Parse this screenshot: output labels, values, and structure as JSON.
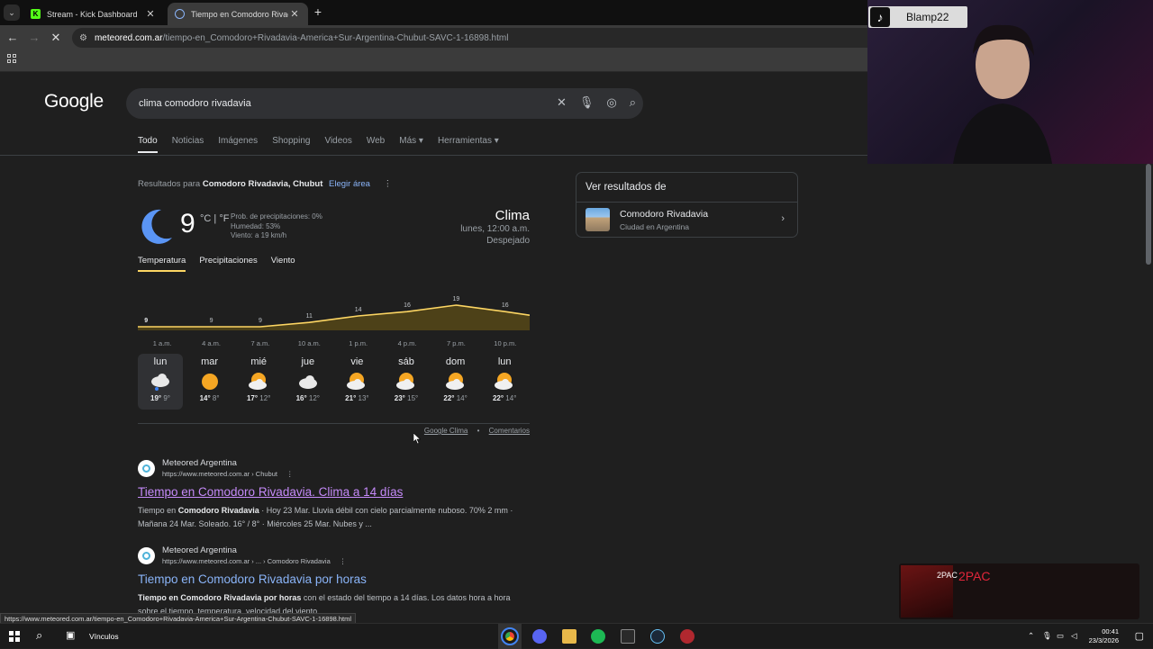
{
  "browser": {
    "tabs": [
      {
        "title": "Stream - Kick Dashboard",
        "icon": "kick-icon",
        "color": "#53fc18"
      },
      {
        "title": "Tiempo en Comodoro Rivadavia",
        "icon": "globe-icon",
        "color": "#8ab4f8"
      }
    ],
    "new_tab": "+",
    "url_host": "meteored.com.ar",
    "url_path": "/tiempo-en_Comodoro+Rivadavia-America+Sur-Argentina-Chubut-SAVC-1-16898.html"
  },
  "google": {
    "logo": "Google",
    "query": "clima comodoro rivadavia",
    "tabs": [
      "Todo",
      "Noticias",
      "Imágenes",
      "Shopping",
      "Videos",
      "Web",
      "Más ▾",
      "Herramientas ▾"
    ]
  },
  "weather": {
    "results_for_prefix": "Resultados para",
    "results_for_place": "Comodoro Rivadavia, Chubut",
    "choose_area": "Elegir área",
    "temp": "9",
    "units": "°C | °F",
    "precip": "Prob. de precipitaciones: 0%",
    "humidity": "Humedad: 53%",
    "wind": "Viento: a 19 km/h",
    "title": "Clima",
    "datetime": "lunes, 12:00 a.m.",
    "condition": "Despejado",
    "tabs": [
      "Temperatura",
      "Precipitaciones",
      "Viento"
    ],
    "footer_link1": "Google Clima",
    "footer_dot": "•",
    "footer_link2": "Comentarios"
  },
  "chart_data": {
    "type": "area",
    "x": [
      "1 a.m.",
      "4 a.m.",
      "7 a.m.",
      "10 a.m.",
      "1 p.m.",
      "4 p.m.",
      "7 p.m.",
      "10 p.m."
    ],
    "values": [
      9,
      9,
      9,
      11,
      14,
      16,
      19,
      16
    ],
    "color": "#fdd663"
  },
  "forecast": [
    {
      "day": "lun",
      "icon": "cloud-rain-icon",
      "high": "19°",
      "low": "9°"
    },
    {
      "day": "mar",
      "icon": "sun-icon",
      "high": "14°",
      "low": "8°"
    },
    {
      "day": "mié",
      "icon": "partly-cloudy-icon",
      "high": "17°",
      "low": "12°"
    },
    {
      "day": "jue",
      "icon": "cloud-icon",
      "high": "16°",
      "low": "12°"
    },
    {
      "day": "vie",
      "icon": "partly-cloudy-icon",
      "high": "21°",
      "low": "13°"
    },
    {
      "day": "sáb",
      "icon": "partly-cloudy-icon",
      "high": "23°",
      "low": "15°"
    },
    {
      "day": "dom",
      "icon": "partly-cloudy-icon",
      "high": "22°",
      "low": "14°"
    },
    {
      "day": "lun",
      "icon": "partly-cloudy-icon",
      "high": "22°",
      "low": "14°"
    }
  ],
  "results": [
    {
      "site": "Meteored Argentina",
      "url": "https://www.meteored.com.ar › Chubut",
      "title": "Tiempo en Comodoro Rivadavia. Clima a 14 días",
      "title_color": "#c58af9",
      "s1a": "Tiempo en ",
      "s1b": "Comodoro Rivadavia",
      "s1c": " · Hoy 23 Mar. Lluvia débil con cielo parcialmente nuboso. 70% 2 mm ·",
      "s2": "Mañana 24 Mar. Soleado. 16° / 8° · Miércoles 25 Mar. Nubes y ..."
    },
    {
      "site": "Meteored Argentina",
      "url": "https://www.meteored.com.ar › ... › Comodoro Rivadavia",
      "title": "Tiempo en Comodoro Rivadavia por horas",
      "title_color": "#8ab4f8",
      "s1a": "",
      "s1b": "Tiempo en Comodoro Rivadavia por horas",
      "s1c": " con el estado del tiempo a 14 días. Los datos hora a hora",
      "s2": "sobre el tiempo, temperatura, velocidad del viento, ..."
    }
  ],
  "side_panel": {
    "heading": "Ver resultados de",
    "name": "Comodoro Rivadavia",
    "desc": "Ciudad en Argentina"
  },
  "stream": {
    "tiktok_user": "Blamp22",
    "music_small": "2PAC",
    "music_title": "2PAC"
  },
  "status_url": "https://www.meteored.com.ar/tiempo-en_Comodoro+Rivadavia-America+Sur-Argentina-Chubut-SAVC-1-16898.html",
  "taskbar": {
    "links_label": "Vínculos",
    "time": "00:41",
    "date": "23/3/2026"
  }
}
